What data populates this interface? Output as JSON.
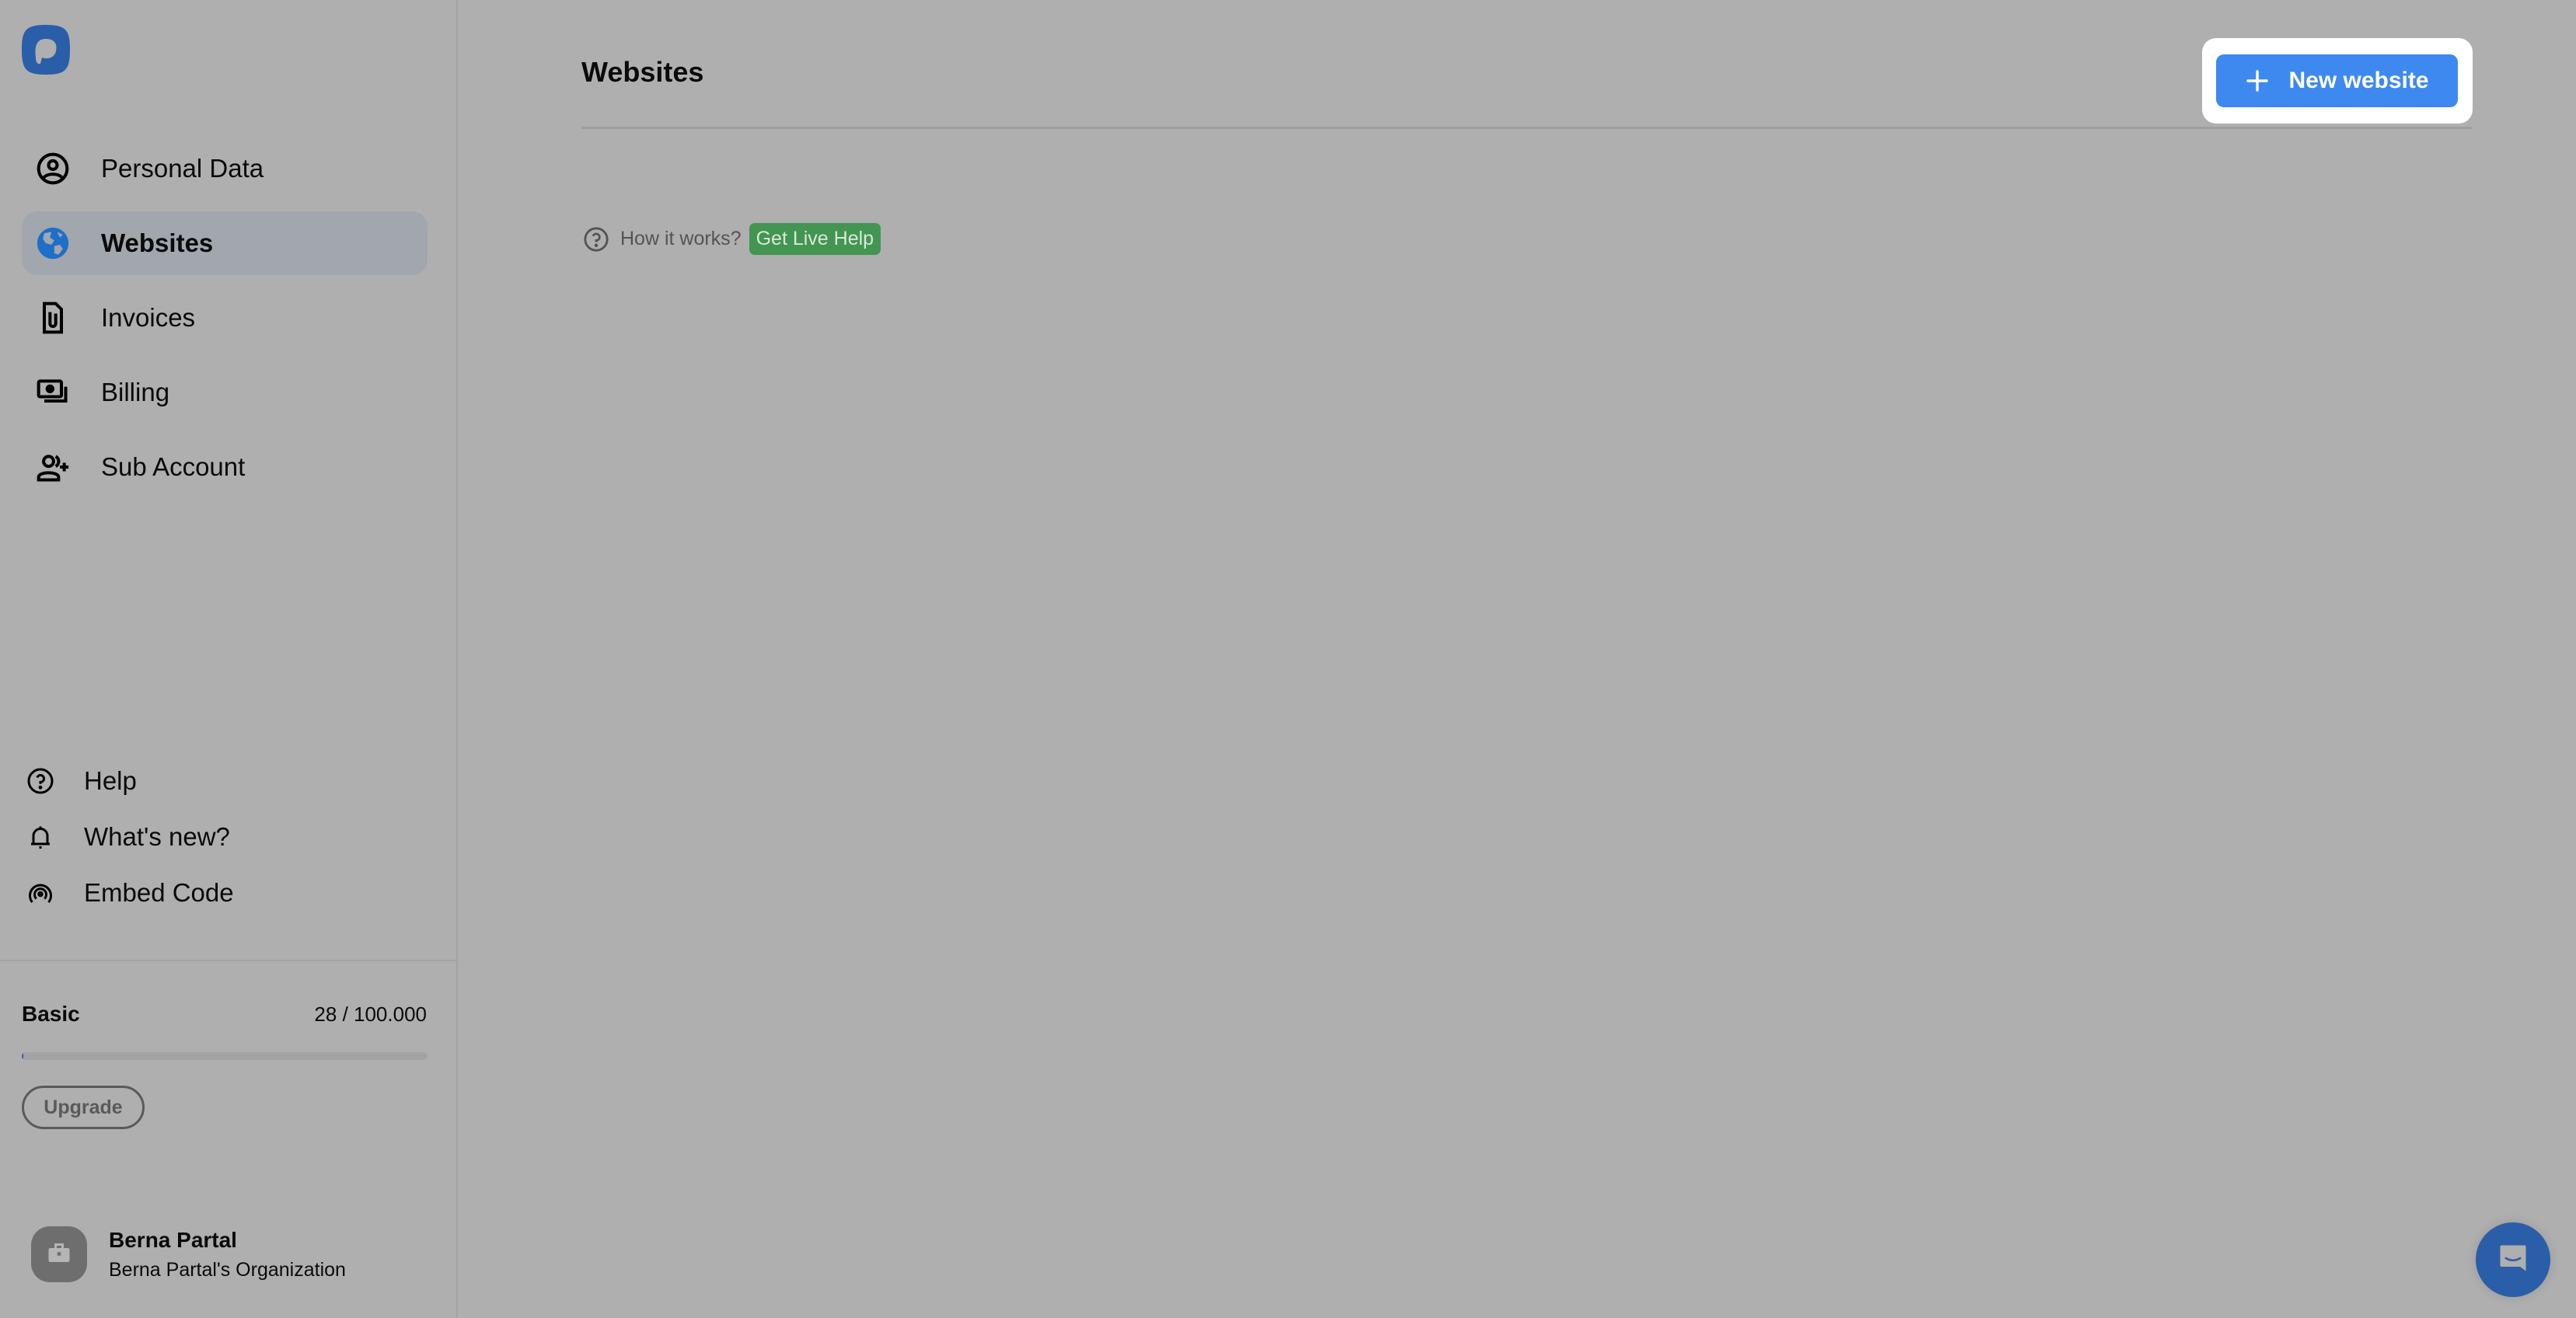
{
  "app": {
    "logo_icon": "speech-bubble-logo-icon",
    "brand_color": "#2b5ea8"
  },
  "sidebar": {
    "nav_items": [
      {
        "label": "Personal Data",
        "icon": "user-circle-icon",
        "active": false
      },
      {
        "label": "Websites",
        "icon": "globe-icon",
        "active": true
      },
      {
        "label": "Invoices",
        "icon": "document-clip-icon",
        "active": false
      },
      {
        "label": "Billing",
        "icon": "money-stack-icon",
        "active": false
      },
      {
        "label": "Sub Account",
        "icon": "user-plus-icon",
        "active": false
      }
    ],
    "bottom_items": [
      {
        "label": "Help",
        "icon": "question-circle-icon"
      },
      {
        "label": "What's new?",
        "icon": "bell-icon"
      },
      {
        "label": "Embed Code",
        "icon": "broadcast-icon"
      }
    ],
    "plan": {
      "name": "Basic",
      "usage_text": "28 / 100.000",
      "used": 28,
      "limit": 100000,
      "upgrade_label": "Upgrade"
    },
    "user": {
      "name": "Berna Partal",
      "organization": "Berna Partal's Organization",
      "avatar_icon": "briefcase-icon"
    }
  },
  "main": {
    "title": "Websites",
    "new_button_label": "New website",
    "how_it_works": "How it works?",
    "live_help_label": "Get Live Help",
    "accent_color": "#3e89ef",
    "live_help_color": "#439552"
  },
  "chat_widget": {
    "icon": "chat-smile-icon"
  }
}
